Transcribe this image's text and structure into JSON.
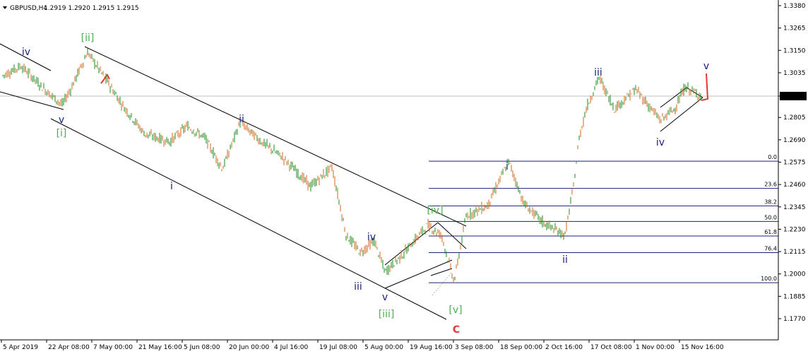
{
  "header": {
    "symbol": "GBPUSD,H4",
    "ohlc": "1.2919 1.2920 1.2915 1.2915"
  },
  "colors": {
    "up_candle": "#1e8a1e",
    "down_candle": "#d2691e",
    "navy": "#1a237e",
    "green_label": "#4caf50",
    "red": "#e53935",
    "fib": "#1a237e",
    "price_line": "#c0c0c0",
    "axis": "#000000"
  },
  "chart_data": {
    "type": "candlestick",
    "ylim": [
      1.177,
      1.338
    ],
    "y_ticks": [
      "1.3380",
      "1.3265",
      "1.3150",
      "1.3035",
      "1.2915",
      "1.2805",
      "1.2690",
      "1.2575",
      "1.2460",
      "1.2345",
      "1.2230",
      "1.2115",
      "1.2000",
      "1.1885",
      "1.1770"
    ],
    "current_price": "1.2915",
    "x_labels": [
      "5 Apr 2019",
      "22 Apr 08:00",
      "7 May 00:00",
      "21 May 16:00",
      "5 Jun 08:00",
      "20 Jun 00:00",
      "4 Jul 16:00",
      "19 Jul 08:00",
      "5 Aug 00:00",
      "19 Aug 16:00",
      "3 Sep 08:00",
      "18 Sep 00:00",
      "2 Oct 16:00",
      "17 Oct 08:00",
      "1 Nov 00:00",
      "15 Nov 16:00"
    ],
    "fib_levels": [
      {
        "label": "0.0",
        "price": 1.258
      },
      {
        "label": "23.6",
        "price": 1.244
      },
      {
        "label": "38.2",
        "price": 1.235
      },
      {
        "label": "50.0",
        "price": 1.227
      },
      {
        "label": "61.8",
        "price": 1.2195
      },
      {
        "label": "76.4",
        "price": 1.211
      },
      {
        "label": "100.0",
        "price": 1.1955
      }
    ],
    "wave_labels": [
      {
        "text": "iv",
        "color": "navy"
      },
      {
        "text": "v",
        "color": "navy"
      },
      {
        "text": "[i]",
        "color": "green"
      },
      {
        "text": "[ii]",
        "color": "green"
      },
      {
        "text": "i",
        "color": "navy"
      },
      {
        "text": "ii",
        "color": "navy"
      },
      {
        "text": "iii",
        "color": "navy"
      },
      {
        "text": "iv",
        "color": "navy"
      },
      {
        "text": "v",
        "color": "navy"
      },
      {
        "text": "[iii]",
        "color": "green"
      },
      {
        "text": "[iv]",
        "color": "green"
      },
      {
        "text": "[v]",
        "color": "green"
      },
      {
        "text": "C",
        "color": "red"
      },
      {
        "text": "i",
        "color": "navy"
      },
      {
        "text": "ii",
        "color": "navy"
      },
      {
        "text": "iii",
        "color": "navy"
      },
      {
        "text": "iv",
        "color": "navy"
      },
      {
        "text": "v",
        "color": "navy"
      }
    ]
  }
}
